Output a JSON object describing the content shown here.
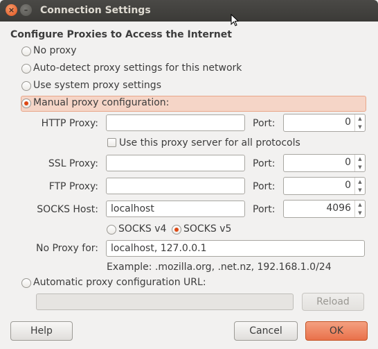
{
  "window": {
    "title": "Connection Settings"
  },
  "heading": "Configure Proxies to Access the Internet",
  "options": {
    "no_proxy": "No proxy",
    "auto_detect": "Auto-detect proxy settings for this network",
    "system": "Use system proxy settings",
    "manual": "Manual proxy configuration:",
    "auto_url": "Automatic proxy configuration URL:"
  },
  "selected_option": "manual",
  "http": {
    "label": "HTTP Proxy:",
    "value": "",
    "port_label": "Port:",
    "port": "0"
  },
  "use_all_label": "Use this proxy server for all protocols",
  "ssl": {
    "label": "SSL Proxy:",
    "value": "",
    "port_label": "Port:",
    "port": "0"
  },
  "ftp": {
    "label": "FTP Proxy:",
    "value": "",
    "port_label": "Port:",
    "port": "0"
  },
  "socks": {
    "label": "SOCKS Host:",
    "value": "localhost",
    "port_label": "Port:",
    "port": "4096"
  },
  "socks_versions": {
    "v4": "SOCKS v4",
    "v5": "SOCKS v5",
    "selected": "v5"
  },
  "no_proxy_for": {
    "label": "No Proxy for:",
    "value": "localhost, 127.0.0.1",
    "example": "Example: .mozilla.org, .net.nz, 192.168.1.0/24"
  },
  "auto_url_value": "",
  "buttons": {
    "reload": "Reload",
    "help": "Help",
    "cancel": "Cancel",
    "ok": "OK"
  },
  "colors": {
    "accent": "#dd4814",
    "title_bar": "#3c3b37"
  }
}
